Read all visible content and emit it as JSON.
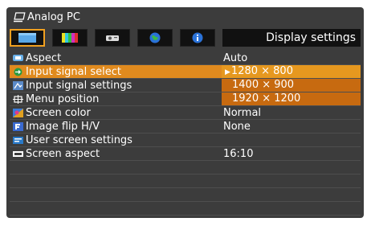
{
  "header": {
    "source_label": "Analog PC",
    "source_icon": "pc-monitor-icon"
  },
  "tabs": [
    {
      "icon": "display-tab-icon",
      "active": true
    },
    {
      "icon": "color-bars-tab-icon",
      "active": false
    },
    {
      "icon": "projector-tab-icon",
      "active": false
    },
    {
      "icon": "globe-tab-icon",
      "active": false
    },
    {
      "icon": "info-tab-icon",
      "active": false
    }
  ],
  "page_title": "Display settings",
  "menu": [
    {
      "label": "Aspect",
      "icon": "aspect-icon",
      "value": "Auto"
    },
    {
      "label": "Input signal select",
      "icon": "input-signal-icon",
      "value": "",
      "selected": true
    },
    {
      "label": "Input signal settings",
      "icon": "signal-settings-icon",
      "value": ""
    },
    {
      "label": "Menu position",
      "icon": "menu-position-icon",
      "value": ""
    },
    {
      "label": "Screen color",
      "icon": "screen-color-icon",
      "value": "Normal"
    },
    {
      "label": "Image flip H/V",
      "icon": "image-flip-icon",
      "value": "None"
    },
    {
      "label": "User screen settings",
      "icon": "user-screen-icon",
      "value": ""
    },
    {
      "label": "Screen aspect",
      "icon": "screen-aspect-icon",
      "value": "16:10"
    }
  ],
  "dropdown": {
    "options": [
      "1280 × 800",
      "1400 × 900",
      "1920 × 1200"
    ],
    "current_marker": "▶"
  },
  "colors": {
    "accent": "#f0a020",
    "selected_row": "#e08a1e",
    "option_bg": "#c76a10",
    "background": "#3c3c3c"
  }
}
